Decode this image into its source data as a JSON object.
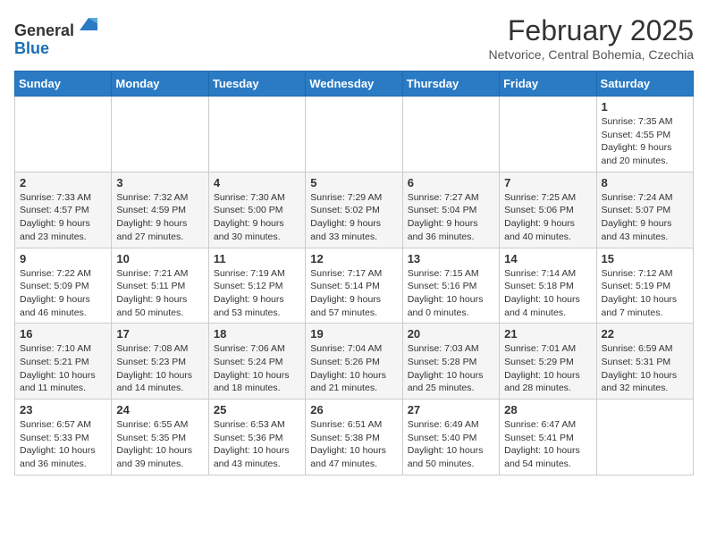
{
  "header": {
    "logo": {
      "line1": "General",
      "line2": "Blue"
    },
    "title": "February 2025",
    "location": "Netvorice, Central Bohemia, Czechia"
  },
  "weekdays": [
    "Sunday",
    "Monday",
    "Tuesday",
    "Wednesday",
    "Thursday",
    "Friday",
    "Saturday"
  ],
  "weeks": [
    [
      {
        "day": "",
        "info": ""
      },
      {
        "day": "",
        "info": ""
      },
      {
        "day": "",
        "info": ""
      },
      {
        "day": "",
        "info": ""
      },
      {
        "day": "",
        "info": ""
      },
      {
        "day": "",
        "info": ""
      },
      {
        "day": "1",
        "info": "Sunrise: 7:35 AM\nSunset: 4:55 PM\nDaylight: 9 hours\nand 20 minutes."
      }
    ],
    [
      {
        "day": "2",
        "info": "Sunrise: 7:33 AM\nSunset: 4:57 PM\nDaylight: 9 hours\nand 23 minutes."
      },
      {
        "day": "3",
        "info": "Sunrise: 7:32 AM\nSunset: 4:59 PM\nDaylight: 9 hours\nand 27 minutes."
      },
      {
        "day": "4",
        "info": "Sunrise: 7:30 AM\nSunset: 5:00 PM\nDaylight: 9 hours\nand 30 minutes."
      },
      {
        "day": "5",
        "info": "Sunrise: 7:29 AM\nSunset: 5:02 PM\nDaylight: 9 hours\nand 33 minutes."
      },
      {
        "day": "6",
        "info": "Sunrise: 7:27 AM\nSunset: 5:04 PM\nDaylight: 9 hours\nand 36 minutes."
      },
      {
        "day": "7",
        "info": "Sunrise: 7:25 AM\nSunset: 5:06 PM\nDaylight: 9 hours\nand 40 minutes."
      },
      {
        "day": "8",
        "info": "Sunrise: 7:24 AM\nSunset: 5:07 PM\nDaylight: 9 hours\nand 43 minutes."
      }
    ],
    [
      {
        "day": "9",
        "info": "Sunrise: 7:22 AM\nSunset: 5:09 PM\nDaylight: 9 hours\nand 46 minutes."
      },
      {
        "day": "10",
        "info": "Sunrise: 7:21 AM\nSunset: 5:11 PM\nDaylight: 9 hours\nand 50 minutes."
      },
      {
        "day": "11",
        "info": "Sunrise: 7:19 AM\nSunset: 5:12 PM\nDaylight: 9 hours\nand 53 minutes."
      },
      {
        "day": "12",
        "info": "Sunrise: 7:17 AM\nSunset: 5:14 PM\nDaylight: 9 hours\nand 57 minutes."
      },
      {
        "day": "13",
        "info": "Sunrise: 7:15 AM\nSunset: 5:16 PM\nDaylight: 10 hours\nand 0 minutes."
      },
      {
        "day": "14",
        "info": "Sunrise: 7:14 AM\nSunset: 5:18 PM\nDaylight: 10 hours\nand 4 minutes."
      },
      {
        "day": "15",
        "info": "Sunrise: 7:12 AM\nSunset: 5:19 PM\nDaylight: 10 hours\nand 7 minutes."
      }
    ],
    [
      {
        "day": "16",
        "info": "Sunrise: 7:10 AM\nSunset: 5:21 PM\nDaylight: 10 hours\nand 11 minutes."
      },
      {
        "day": "17",
        "info": "Sunrise: 7:08 AM\nSunset: 5:23 PM\nDaylight: 10 hours\nand 14 minutes."
      },
      {
        "day": "18",
        "info": "Sunrise: 7:06 AM\nSunset: 5:24 PM\nDaylight: 10 hours\nand 18 minutes."
      },
      {
        "day": "19",
        "info": "Sunrise: 7:04 AM\nSunset: 5:26 PM\nDaylight: 10 hours\nand 21 minutes."
      },
      {
        "day": "20",
        "info": "Sunrise: 7:03 AM\nSunset: 5:28 PM\nDaylight: 10 hours\nand 25 minutes."
      },
      {
        "day": "21",
        "info": "Sunrise: 7:01 AM\nSunset: 5:29 PM\nDaylight: 10 hours\nand 28 minutes."
      },
      {
        "day": "22",
        "info": "Sunrise: 6:59 AM\nSunset: 5:31 PM\nDaylight: 10 hours\nand 32 minutes."
      }
    ],
    [
      {
        "day": "23",
        "info": "Sunrise: 6:57 AM\nSunset: 5:33 PM\nDaylight: 10 hours\nand 36 minutes."
      },
      {
        "day": "24",
        "info": "Sunrise: 6:55 AM\nSunset: 5:35 PM\nDaylight: 10 hours\nand 39 minutes."
      },
      {
        "day": "25",
        "info": "Sunrise: 6:53 AM\nSunset: 5:36 PM\nDaylight: 10 hours\nand 43 minutes."
      },
      {
        "day": "26",
        "info": "Sunrise: 6:51 AM\nSunset: 5:38 PM\nDaylight: 10 hours\nand 47 minutes."
      },
      {
        "day": "27",
        "info": "Sunrise: 6:49 AM\nSunset: 5:40 PM\nDaylight: 10 hours\nand 50 minutes."
      },
      {
        "day": "28",
        "info": "Sunrise: 6:47 AM\nSunset: 5:41 PM\nDaylight: 10 hours\nand 54 minutes."
      },
      {
        "day": "",
        "info": ""
      }
    ]
  ]
}
